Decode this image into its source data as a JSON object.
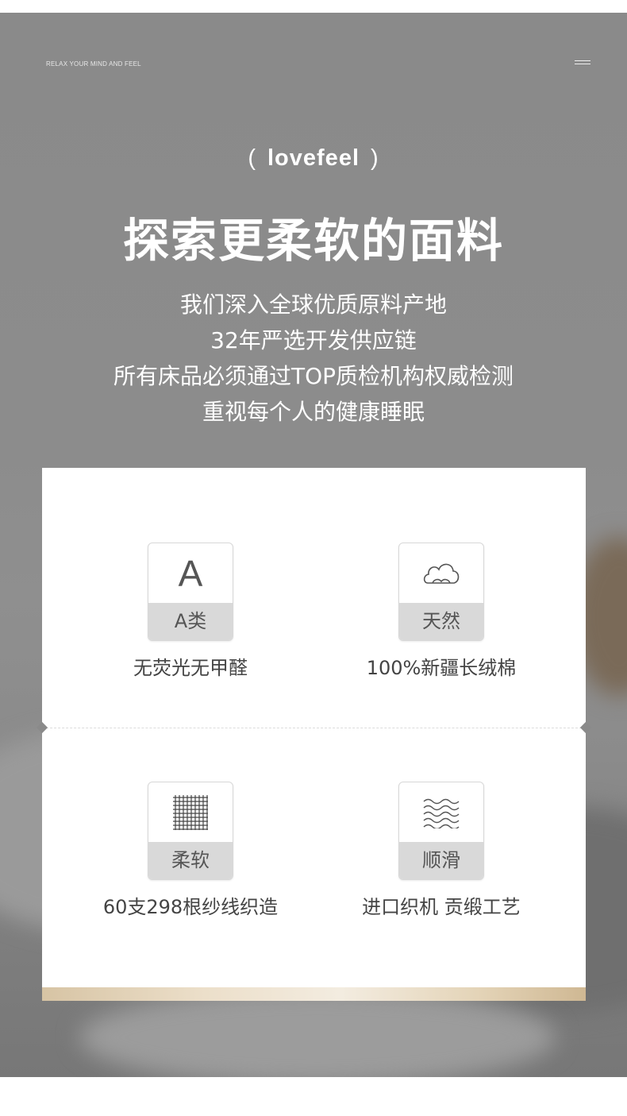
{
  "header": {
    "tagline": "RELAX YOUR MIND AND FEEL",
    "menu_icon": "hamburger-menu-icon"
  },
  "hero": {
    "brand_left_paren": "(",
    "brand": "lovefeel",
    "brand_right_paren": ")",
    "headline": "探索更柔软的面料",
    "description_lines": [
      "我们深入全球优质原料产地",
      "32年严选开发供应链",
      "所有床品必须通过TOP质检机构权威检测",
      "重视每个人的健康睡眠"
    ]
  },
  "features": [
    {
      "icon": "letter-a-icon",
      "icon_text": "A",
      "label": "A类",
      "caption": "无荧光无甲醛"
    },
    {
      "icon": "cloud-icon",
      "label": "天然",
      "caption": "100%新疆长绒棉"
    },
    {
      "icon": "grid-weave-icon",
      "label": "柔软",
      "caption": "60支298根纱线织造"
    },
    {
      "icon": "wave-lines-icon",
      "label": "顺滑",
      "caption": "进口织机 贡缎工艺"
    }
  ],
  "colors": {
    "hero_background": "#8a8a8a",
    "badge_label_background": "#d9d9d9",
    "text_dark": "#444444",
    "gold_accent": "#d7c4a4"
  }
}
